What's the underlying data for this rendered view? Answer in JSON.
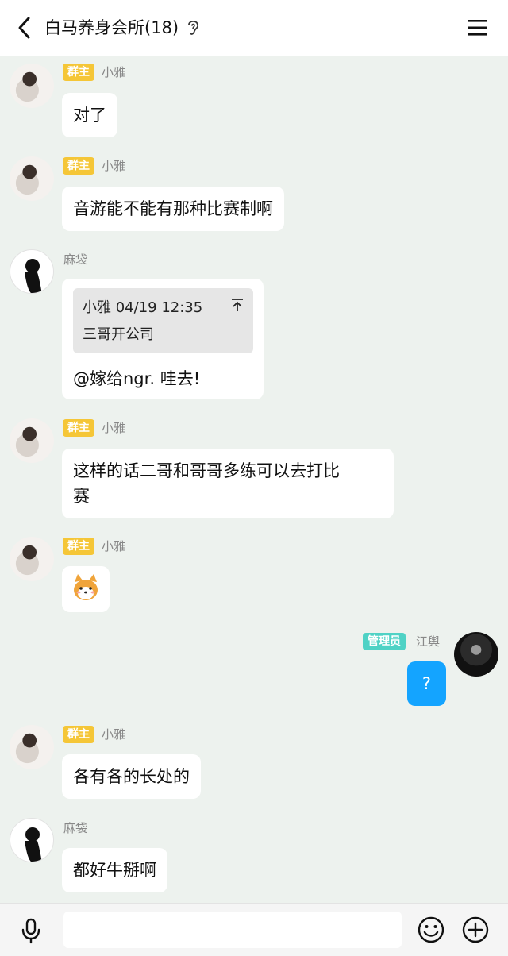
{
  "header": {
    "title": "白马养身会所(18)"
  },
  "messages": [
    {
      "sender": "小雅",
      "badge": "群主",
      "text": "对了"
    },
    {
      "sender": "小雅",
      "badge": "群主",
      "text": "音游能不能有那种比赛制啊"
    },
    {
      "sender": "麻袋",
      "quote": {
        "head": "小雅 04/19 12:35",
        "body": "三哥开公司"
      },
      "text": "@嫁给ngr. 哇去!"
    },
    {
      "sender": "小雅",
      "badge": "群主",
      "text_line1": "这样的话二哥和哥哥多练可以去打比",
      "text_line2": "赛"
    },
    {
      "sender": "小雅",
      "badge": "群主",
      "emoji": "shiba-dog-emoji"
    },
    {
      "sender": "江舆",
      "badge": "管理员",
      "text": "?"
    },
    {
      "sender": "小雅",
      "badge": "群主",
      "text": "各有各的长处的"
    },
    {
      "sender": "麻袋",
      "text": "都好牛掰啊"
    }
  ],
  "colors": {
    "owner_badge": "#f5c637",
    "admin_badge": "#4fd2c5",
    "self_bubble": "#14a4ff",
    "chat_bg": "#edf2ee"
  },
  "icons": {
    "back": "chevron-left-icon",
    "ear": "ear-icon",
    "menu": "menu-icon",
    "mic": "mic-icon",
    "emoji": "emoji-icon",
    "plus": "plus-icon",
    "quote_jump": "arrow-up-icon"
  }
}
